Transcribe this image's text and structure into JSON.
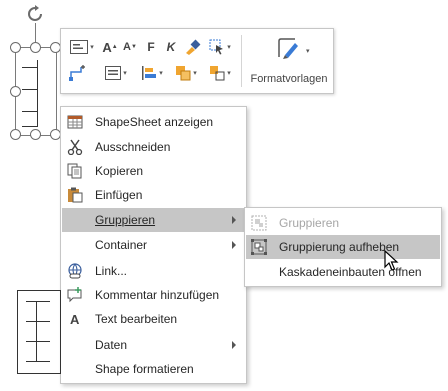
{
  "mini_toolbar": {
    "icons": [
      "shape-fill-icon",
      "font-increase-icon",
      "font-decrease-icon",
      "bold-icon",
      "italic-icon",
      "format-painter-icon",
      "pointer-tool-icon",
      "connector-icon",
      "align-text-icon",
      "position-icon",
      "arrange-icon",
      "styles-icon"
    ],
    "font_grow_glyph": "A",
    "font_shrink_glyph": "A",
    "bold_glyph": "F",
    "italic_glyph": "K",
    "formatvorlagen_label": "Formatvorlagen"
  },
  "context_menu": {
    "items": [
      {
        "label": "ShapeSheet anzeigen",
        "icon": "shapesheet-icon",
        "has_submenu": false
      },
      {
        "label": "Ausschneiden",
        "icon": "scissors-icon",
        "has_submenu": false
      },
      {
        "label": "Kopieren",
        "icon": "copy-icon",
        "has_submenu": false
      },
      {
        "label": "Einfügen",
        "icon": "paste-icon",
        "has_submenu": false
      },
      {
        "label": "Gruppieren",
        "icon": "",
        "has_submenu": true,
        "highlighted": true
      },
      {
        "label": "Container",
        "icon": "",
        "has_submenu": true
      },
      {
        "label": "Link...",
        "icon": "link-icon",
        "has_submenu": false
      },
      {
        "label": "Kommentar hinzufügen",
        "icon": "comment-icon",
        "has_submenu": false
      },
      {
        "label": "Text bearbeiten",
        "icon": "text-edit-icon",
        "has_submenu": false
      },
      {
        "label": "Daten",
        "icon": "",
        "has_submenu": true
      },
      {
        "label": "Shape formatieren",
        "icon": "",
        "has_submenu": false
      }
    ]
  },
  "submenu": {
    "items": [
      {
        "label": "Gruppieren",
        "icon": "group-icon",
        "disabled": true
      },
      {
        "label": "Gruppierung aufheben",
        "icon": "ungroup-icon",
        "disabled": false,
        "highlighted": true
      },
      {
        "label": "Kaskadeneinbauten öffnen",
        "icon": "",
        "disabled": false
      }
    ]
  },
  "colors": {
    "highlight": "#c6c6c6",
    "border": "#c6c6c6",
    "disabled_text": "#a6a6a6"
  }
}
